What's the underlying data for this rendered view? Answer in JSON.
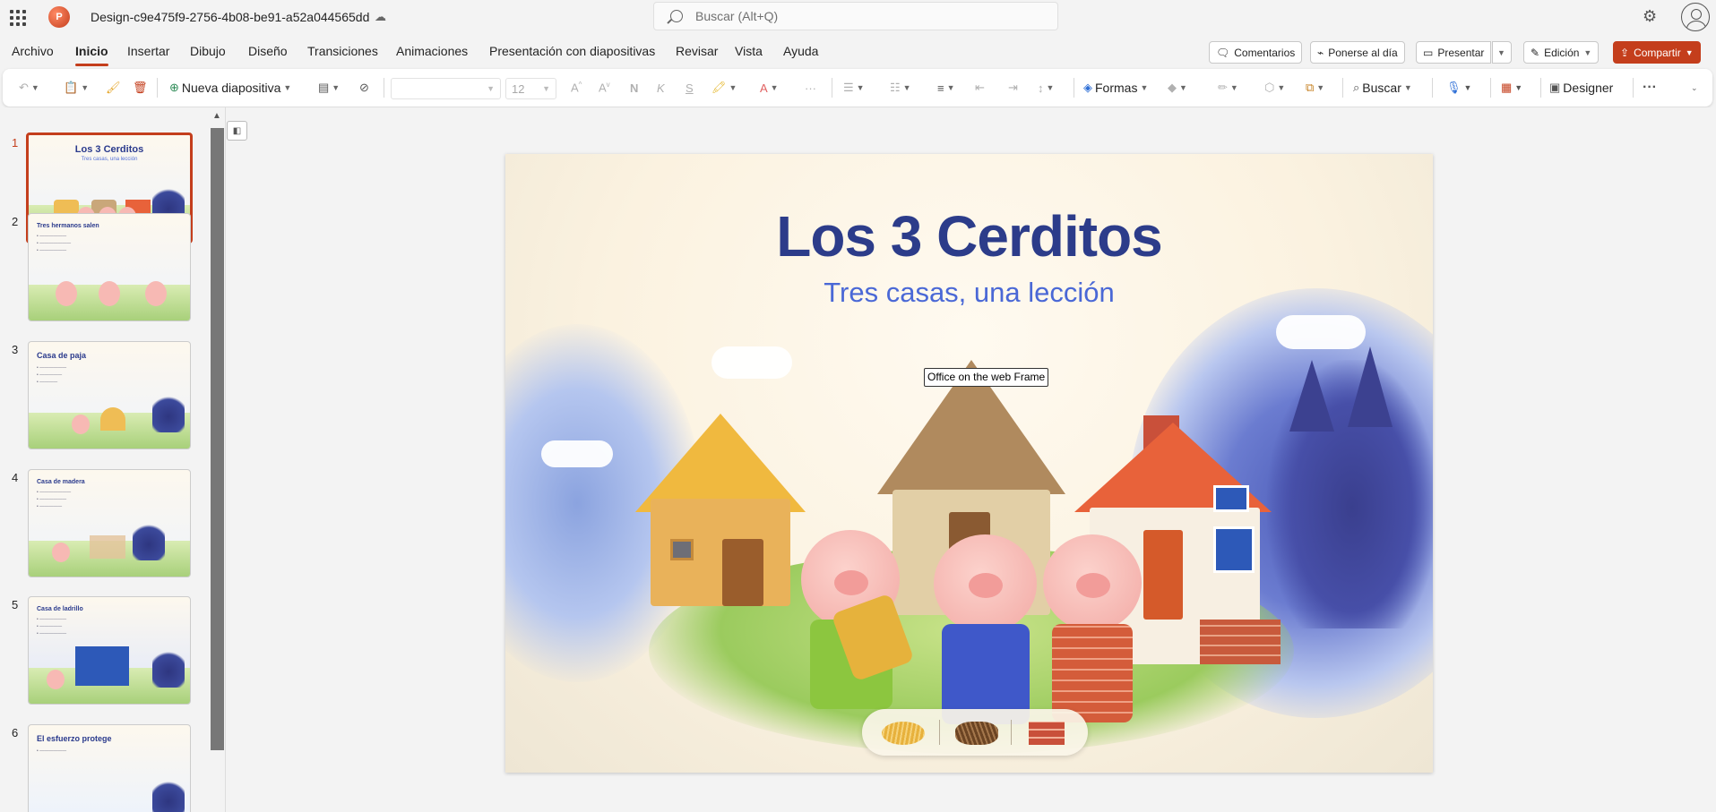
{
  "app": {
    "doc_title": "Design-c9e475f9-2756-4b08-be91-a52a044565dd",
    "logo_letter": "P",
    "search_placeholder": "Buscar (Alt+Q)"
  },
  "menu": {
    "items": [
      "Archivo",
      "Inicio",
      "Insertar",
      "Dibujo",
      "Diseño",
      "Transiciones",
      "Animaciones",
      "Presentación con diapositivas",
      "Revisar",
      "Vista",
      "Ayuda"
    ],
    "active": "Inicio"
  },
  "top_buttons": {
    "comments": "Comentarios",
    "catch_up": "Ponerse al día",
    "present": "Presentar",
    "editing": "Edición",
    "share": "Compartir"
  },
  "ribbon": {
    "new_slide": "Nueva diapositiva",
    "font_size": "12",
    "shapes": "Formas",
    "find": "Buscar",
    "designer": "Designer"
  },
  "thumbnails": [
    {
      "num": "1",
      "title": "Los 3 Cerditos",
      "sub": "Tres casas, una lección",
      "bullets": []
    },
    {
      "num": "2",
      "title": "Tres hermanos salen",
      "sub": "",
      "bullets": []
    },
    {
      "num": "3",
      "title": "Casa de paja",
      "sub": "",
      "bullets": []
    },
    {
      "num": "4",
      "title": "Casa de madera",
      "sub": "",
      "bullets": []
    },
    {
      "num": "5",
      "title": "Casa de ladrillo",
      "sub": "",
      "bullets": []
    },
    {
      "num": "6",
      "title": "El esfuerzo protege",
      "sub": "",
      "bullets": []
    }
  ],
  "slide": {
    "title": "Los 3 Cerditos",
    "subtitle": "Tres casas, una lección"
  },
  "tooltip": "Office on the web Frame",
  "colors": {
    "accent": "#c43e1c",
    "title_blue": "#2c3c8a",
    "subtitle_blue": "#4a68d6"
  }
}
